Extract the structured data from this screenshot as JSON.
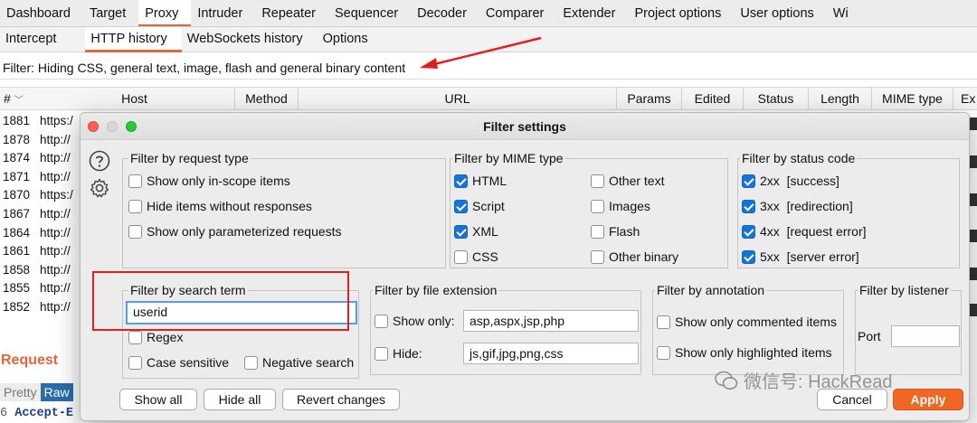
{
  "top_tabs": [
    "Dashboard",
    "Target",
    "Proxy",
    "Intruder",
    "Repeater",
    "Sequencer",
    "Decoder",
    "Comparer",
    "Extender",
    "Project options",
    "User options",
    "Wi"
  ],
  "sub_tabs": [
    "Intercept",
    "HTTP history",
    "WebSockets history",
    "Options"
  ],
  "filter_text": "Filter: Hiding CSS, general text, image, flash and general binary content",
  "columns": {
    "num": "#",
    "host": "Host",
    "method": "Method",
    "url": "URL",
    "params": "Params",
    "edited": "Edited",
    "status": "Status",
    "length": "Length",
    "mime": "MIME type",
    "ext": "Ex"
  },
  "rows": [
    {
      "id": "1881",
      "host": "https:/"
    },
    {
      "id": "1878",
      "host": "http://"
    },
    {
      "id": "1874",
      "host": "http://"
    },
    {
      "id": "1871",
      "host": "http://"
    },
    {
      "id": "1870",
      "host": "https:/"
    },
    {
      "id": "1867",
      "host": "http://"
    },
    {
      "id": "1864",
      "host": "http://"
    },
    {
      "id": "1861",
      "host": "http://"
    },
    {
      "id": "1858",
      "host": "http://"
    },
    {
      "id": "1855",
      "host": "http://"
    },
    {
      "id": "1852",
      "host": "http://"
    }
  ],
  "request": {
    "title": "Request",
    "tabs": [
      "Pretty",
      "Raw"
    ],
    "line_number": "6",
    "line_text": "Accept-E"
  },
  "dialog": {
    "title": "Filter settings",
    "request_type": {
      "title": "Filter by request type",
      "items": [
        {
          "label": "Show only in-scope items",
          "checked": false
        },
        {
          "label": "Hide items without responses",
          "checked": false
        },
        {
          "label": "Show only parameterized requests",
          "checked": false
        }
      ]
    },
    "mime_type": {
      "title": "Filter by MIME type",
      "left": [
        {
          "label": "HTML",
          "checked": true
        },
        {
          "label": "Script",
          "checked": true
        },
        {
          "label": "XML",
          "checked": true
        },
        {
          "label": "CSS",
          "checked": false
        }
      ],
      "right": [
        {
          "label": "Other text",
          "checked": false
        },
        {
          "label": "Images",
          "checked": false
        },
        {
          "label": "Flash",
          "checked": false
        },
        {
          "label": "Other binary",
          "checked": false
        }
      ]
    },
    "status_code": {
      "title": "Filter by status code",
      "items": [
        {
          "label": "2xx  [success]",
          "checked": true
        },
        {
          "label": "3xx  [redirection]",
          "checked": true
        },
        {
          "label": "4xx  [request error]",
          "checked": true
        },
        {
          "label": "5xx  [server error]",
          "checked": true
        }
      ]
    },
    "search_term": {
      "title": "Filter by search term",
      "value": "userid",
      "regex": "Regex",
      "case_sensitive": "Case sensitive",
      "negative_search": "Negative search"
    },
    "file_extension": {
      "title": "Filter by file extension",
      "show_only_label": "Show only:",
      "show_only_value": "asp,aspx,jsp,php",
      "hide_label": "Hide:",
      "hide_value": "js,gif,jpg,png,css"
    },
    "annotation": {
      "title": "Filter by annotation",
      "commented": "Show only commented items",
      "highlighted": "Show only highlighted items"
    },
    "listener": {
      "title": "Filter by listener",
      "port_label": "Port",
      "port_value": ""
    },
    "buttons": {
      "show_all": "Show all",
      "hide_all": "Hide all",
      "revert": "Revert changes",
      "cancel": "Cancel",
      "apply": "Apply"
    }
  },
  "watermark": "微信号: HackRead",
  "colors": {
    "accent": "#e8633a",
    "apply": "#f06623",
    "checkbox": "#1673d8",
    "annotation_red": "#e02020"
  }
}
